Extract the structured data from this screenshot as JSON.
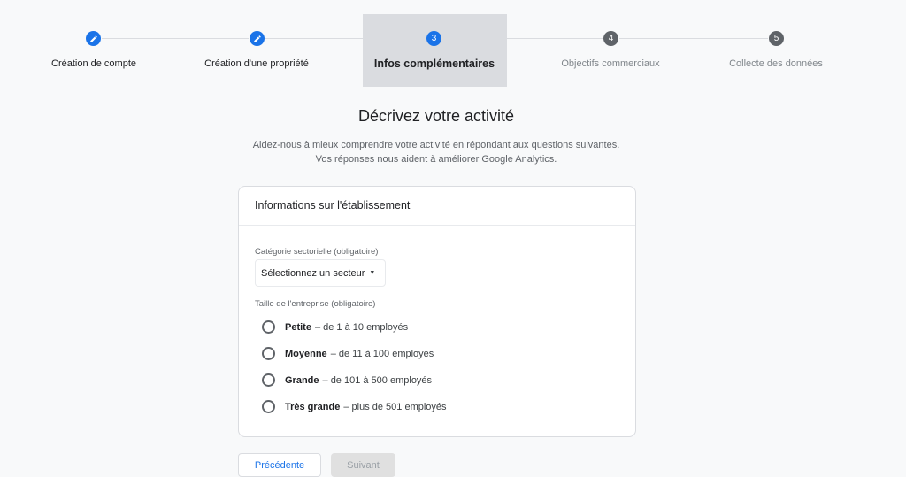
{
  "stepper": {
    "steps": [
      {
        "number": "1",
        "label": "Création de compte",
        "state": "done",
        "icon": "pencil-icon"
      },
      {
        "number": "2",
        "label": "Création d'une propriété",
        "state": "done",
        "icon": "pencil-icon"
      },
      {
        "number": "3",
        "label": "Infos complémentaires",
        "state": "active"
      },
      {
        "number": "4",
        "label": "Objectifs commerciaux",
        "state": "todo"
      },
      {
        "number": "5",
        "label": "Collecte des données",
        "state": "todo"
      }
    ]
  },
  "page": {
    "title": "Décrivez votre activité",
    "subtitle_line1": "Aidez-nous à mieux comprendre votre activité en répondant aux questions suivantes.",
    "subtitle_line2": "Vos réponses nous aident à améliorer Google Analytics."
  },
  "card": {
    "header": "Informations sur l'établissement",
    "category_label": "Catégorie sectorielle (obligatoire)",
    "category_value": "Sélectionnez un secteur",
    "size_label": "Taille de l'entreprise (obligatoire)",
    "size_options": [
      {
        "name": "Petite",
        "detail": "– de 1 à 10 employés"
      },
      {
        "name": "Moyenne",
        "detail": "– de 11 à 100 employés"
      },
      {
        "name": "Grande",
        "detail": "– de 101 à 500 employés"
      },
      {
        "name": "Très grande",
        "detail": "– plus de 501 employés"
      }
    ]
  },
  "buttons": {
    "previous": "Précédente",
    "next": "Suivant"
  },
  "colors": {
    "accent": "#1a73e8",
    "inactive_step": "#5f6368",
    "highlight": "#dadce0"
  }
}
